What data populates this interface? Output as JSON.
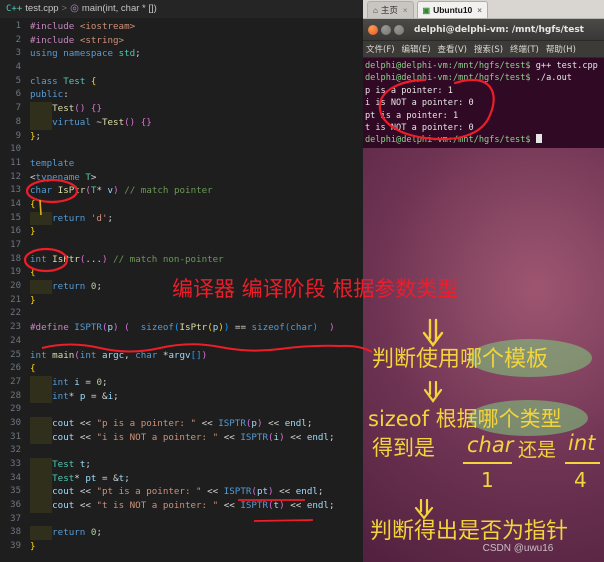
{
  "editor": {
    "breadcrumb": {
      "lang_icon": "cpp-file-icon",
      "file": "test.cpp",
      "separator": ">",
      "symbol_icon": "method-symbol-icon",
      "symbol": "main(int, char * [])"
    },
    "lines": [
      {
        "n": "1",
        "html": "<span class='pre'>#include</span> <span class='hdr'>&lt;iostream&gt;</span>"
      },
      {
        "n": "2",
        "html": "<span class='pre'>#include</span> <span class='hdr'>&lt;string&gt;</span>"
      },
      {
        "n": "3",
        "html": "<span class='kw'>using</span> <span class='kw'>namespace</span> <span class='typ'>std</span>;"
      },
      {
        "n": "4",
        "html": ""
      },
      {
        "n": "5",
        "html": "<span class='kw'>class</span> <span class='typ'>Test</span> <span class='br1'>{</span>"
      },
      {
        "n": "6",
        "html": "<span class='kw'>public</span>:"
      },
      {
        "n": "7",
        "html": "<span class='ind'>    </span><span class='fn'>Test</span><span class='br2'>()</span> <span class='br2'>{}</span>"
      },
      {
        "n": "8",
        "html": "<span class='ind'>    </span><span class='kw'>virtual</span> <span class='op'>~</span><span class='fn'>Test</span><span class='br2'>()</span> <span class='br2'>{}</span>"
      },
      {
        "n": "9",
        "html": "<span class='br1'>}</span>;"
      },
      {
        "n": "10",
        "html": ""
      },
      {
        "n": "11",
        "html": "<span class='kw'>template</span>"
      },
      {
        "n": "12",
        "html": "<span class='op'>&lt;</span><span class='kw'>typename</span> <span class='typ'>T</span><span class='op'>&gt;</span>"
      },
      {
        "n": "13",
        "html": "<span class='kw'>char</span> <span class='fn'>IsPtr</span><span class='br2'>(</span><span class='typ'>T</span><span class='op'>*</span> <span class='var'>v</span><span class='br2'>)</span> <span class='cmt'>// match pointer</span>"
      },
      {
        "n": "14",
        "html": "<span class='br1'>{</span>"
      },
      {
        "n": "15",
        "html": "<span class='ind'>    </span><span class='kw'>return</span> <span class='str'>'d'</span>;"
      },
      {
        "n": "16",
        "html": "<span class='br1'>}</span>"
      },
      {
        "n": "17",
        "html": ""
      },
      {
        "n": "18",
        "html": "<span class='kw'>int</span> <span class='fn'>IsPtr</span><span class='br2'>(</span>...<span class='br2'>)</span> <span class='cmt'>// match non-pointer</span>"
      },
      {
        "n": "19",
        "html": "<span class='br1'>{</span>"
      },
      {
        "n": "20",
        "html": "<span class='ind'>    </span><span class='kw'>return</span> <span class='num'>0</span>;"
      },
      {
        "n": "21",
        "html": "<span class='br1'>}</span>"
      },
      {
        "n": "22",
        "html": ""
      },
      {
        "n": "23",
        "html": "<span class='pre'>#define</span> <span class='mac'>ISPTR</span><span class='br2'>(</span><span class='var'>p</span><span class='br2'>)</span> <span class='br2'>(</span>  <span class='kw'>sizeof</span><span class='br3'>(</span><span class='fn'>IsPtr</span><span class='br1'>(</span><span class='var'>p</span><span class='br1'>)</span><span class='br3'>)</span> <span class='op'>==</span> <span class='kw'>sizeof</span><span class='br3'>(</span><span class='kw'>char</span><span class='br3'>)</span>  <span class='br2'>)</span>"
      },
      {
        "n": "24",
        "html": ""
      },
      {
        "n": "25",
        "html": "<span class='kw'>int</span> <span class='fn'>main</span><span class='br2'>(</span><span class='kw'>int</span> <span class='var'>argc</span>, <span class='kw'>char</span> <span class='op'>*</span><span class='var'>argv</span><span class='br3'>[]</span><span class='br2'>)</span>"
      },
      {
        "n": "26",
        "html": "<span class='br1'>{</span>"
      },
      {
        "n": "27",
        "html": "<span class='ind'>    </span><span class='kw'>int</span> <span class='var'>i</span> <span class='op'>=</span> <span class='num'>0</span>;"
      },
      {
        "n": "28",
        "html": "<span class='ind'>    </span><span class='kw'>int</span><span class='op'>*</span> <span class='var'>p</span> <span class='op'>=</span> <span class='op'>&amp;</span><span class='var'>i</span>;"
      },
      {
        "n": "29",
        "html": ""
      },
      {
        "n": "30",
        "html": "<span class='ind'>    </span><span class='var'>cout</span> <span class='op'>&lt;&lt;</span> <span class='str'>\"p is a pointer: \"</span> <span class='op'>&lt;&lt;</span> <span class='mac'>ISPTR</span><span class='br2'>(</span><span class='var'>p</span><span class='br2'>)</span> <span class='op'>&lt;&lt;</span> <span class='var'>endl</span>;"
      },
      {
        "n": "31",
        "html": "<span class='ind'>    </span><span class='var'>cout</span> <span class='op'>&lt;&lt;</span> <span class='str'>\"i is NOT a pointer: \"</span> <span class='op'>&lt;&lt;</span> <span class='mac'>ISPTR</span><span class='br2'>(</span><span class='var'>i</span><span class='br2'>)</span> <span class='op'>&lt;&lt;</span> <span class='var'>endl</span>;"
      },
      {
        "n": "32",
        "html": ""
      },
      {
        "n": "33",
        "html": "<span class='ind'>    </span><span class='typ'>Test</span> <span class='var'>t</span>;"
      },
      {
        "n": "34",
        "html": "<span class='ind'>    </span><span class='typ'>Test</span><span class='op'>*</span> <span class='var'>pt</span> <span class='op'>=</span> <span class='op'>&amp;</span><span class='var'>t</span>;"
      },
      {
        "n": "35",
        "html": "<span class='ind'>    </span><span class='var'>cout</span> <span class='op'>&lt;&lt;</span> <span class='str'>\"pt is a pointer: \"</span> <span class='op'>&lt;&lt;</span> <span class='mac'>ISPTR</span><span class='br2'>(</span><span class='var'>pt</span><span class='br2'>)</span> <span class='op'>&lt;&lt;</span> <span class='var'>endl</span>;"
      },
      {
        "n": "36",
        "html": "<span class='ind'>    </span><span class='var'>cout</span> <span class='op'>&lt;&lt;</span> <span class='str'>\"t is NOT a pointer: \"</span> <span class='op'>&lt;&lt;</span> <span class='mac'>ISPTR</span><span class='br2'>(</span><span class='var'>t</span><span class='br2'>)</span> <span class='op'>&lt;&lt;</span> <span class='var'>endl</span>;"
      },
      {
        "n": "37",
        "html": ""
      },
      {
        "n": "38",
        "html": "<span class='ind'>    </span><span class='kw'>return</span> <span class='num'>0</span>;"
      },
      {
        "n": "39",
        "html": "<span class='br1'>}</span>"
      }
    ]
  },
  "browser_tabs": [
    {
      "icon": "home-icon",
      "label": "主页",
      "active": false,
      "close": "×"
    },
    {
      "icon": "ubuntu-window-icon",
      "label": "Ubuntu10",
      "active": true,
      "close": "×"
    }
  ],
  "terminal": {
    "window_title": "delphi@delphi-vm: /mnt/hgfs/test",
    "window_buttons": [
      "close-button",
      "minimize-button",
      "maximize-button"
    ],
    "menu": [
      "文件(F)",
      "编辑(E)",
      "查看(V)",
      "搜索(S)",
      "终端(T)",
      "帮助(H)"
    ],
    "prompt": "delphi@delphi-vm:/mnt/hgfs/test$",
    "lines": [
      {
        "prompt": "delphi@delphi-vm:/mnt/hgfs/test$",
        "cmd": " g++ test.cpp"
      },
      {
        "prompt": "delphi@delphi-vm:/mnt/hgfs/test$",
        "cmd": " ./a.out"
      },
      {
        "prompt": "",
        "cmd": "p is a pointer: 1"
      },
      {
        "prompt": "",
        "cmd": "i is NOT a pointer: 0"
      },
      {
        "prompt": "",
        "cmd": "pt is a pointer: 1"
      },
      {
        "prompt": "",
        "cmd": "t is NOT a pointer: 0"
      }
    ]
  },
  "annotations": {
    "red_text_top": "编译器 编译阶段 根据参数类型",
    "yellow_line_1": "判断使用哪个模板",
    "yellow_line_2": "sizeof 根据哪个类型",
    "yellow_line_3": "得到是",
    "yellow_char": "char",
    "yellow_or": "还是",
    "yellow_int": "int",
    "yellow_num_1": "1",
    "yellow_num_4": "4",
    "yellow_line_4": "判断得出是否为指针",
    "watermark": "CSDN @uwu16",
    "red_circles": [
      "char-keyword-circle",
      "int-keyword-circle",
      "terminal-output-circle"
    ],
    "red_underlines": [
      "define-underline",
      "isptr-pt-underline",
      "isptr-t-underline"
    ],
    "arrows": [
      "down-arrow-1",
      "down-arrow-2",
      "down-arrow-3",
      "down-arrow-4"
    ]
  },
  "colors": {
    "editor_bg": "#1e1e1e",
    "terminal_bg": "#300a24",
    "anno_red": "#ee1d2a",
    "anno_yellow": "#f2d43c",
    "highlight_green": "#7fce7f"
  }
}
